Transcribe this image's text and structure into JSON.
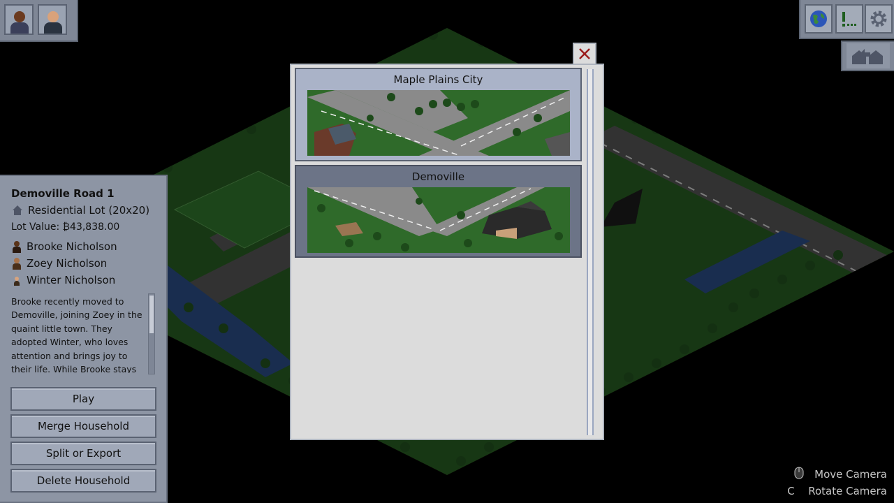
{
  "top_left": {
    "portraits": [
      {
        "name": "portrait-1",
        "skin": "#6b3a1e",
        "hair": "#2a1a10",
        "shirt": "#3b3f5a"
      },
      {
        "name": "portrait-2",
        "skin": "#d9a27a",
        "hair": "#3a2a1c",
        "shirt": "#2a3340"
      }
    ]
  },
  "top_right": {
    "buttons": [
      "globe-icon",
      "alert-icon",
      "gear-icon"
    ],
    "second_row": [
      "move-household-icon"
    ]
  },
  "info_panel": {
    "title": "Demoville Road 1",
    "lot_type": "Residential Lot (20x20)",
    "lot_value": "Lot Value: ₿43,838.00",
    "members": [
      {
        "name": "Brooke Nicholson",
        "skin": "#5a3318",
        "hair": "#2b1a0f"
      },
      {
        "name": "Zoey Nicholson",
        "skin": "#a77148",
        "hair": "#4a2f1a"
      },
      {
        "name": "Winter Nicholson",
        "skin": "#d8a47e",
        "hair": "#3b2a1a"
      }
    ],
    "description": "Brooke recently moved to Demoville, joining Zoey in the quaint little town. They adopted Winter, who loves attention and brings joy to their life. While Brooke stays",
    "buttons": {
      "play": "Play",
      "merge": "Merge Household",
      "split": "Split or Export",
      "delete": "Delete Household"
    }
  },
  "dialog": {
    "cities": [
      {
        "name": "Maple Plains City",
        "selected": true
      },
      {
        "name": "Demoville",
        "selected": false
      }
    ]
  },
  "hints": {
    "move_key": "",
    "move_label": "Move Camera",
    "rotate_key": "C",
    "rotate_label": "Rotate Camera"
  },
  "colors": {
    "panel": "#8d95a4",
    "dialog_bg": "#dcdcdc",
    "card_selected": "#aab3c8",
    "card_normal": "#6c7487",
    "grass": "#2f6a2a",
    "road": "#5a5a5a"
  }
}
